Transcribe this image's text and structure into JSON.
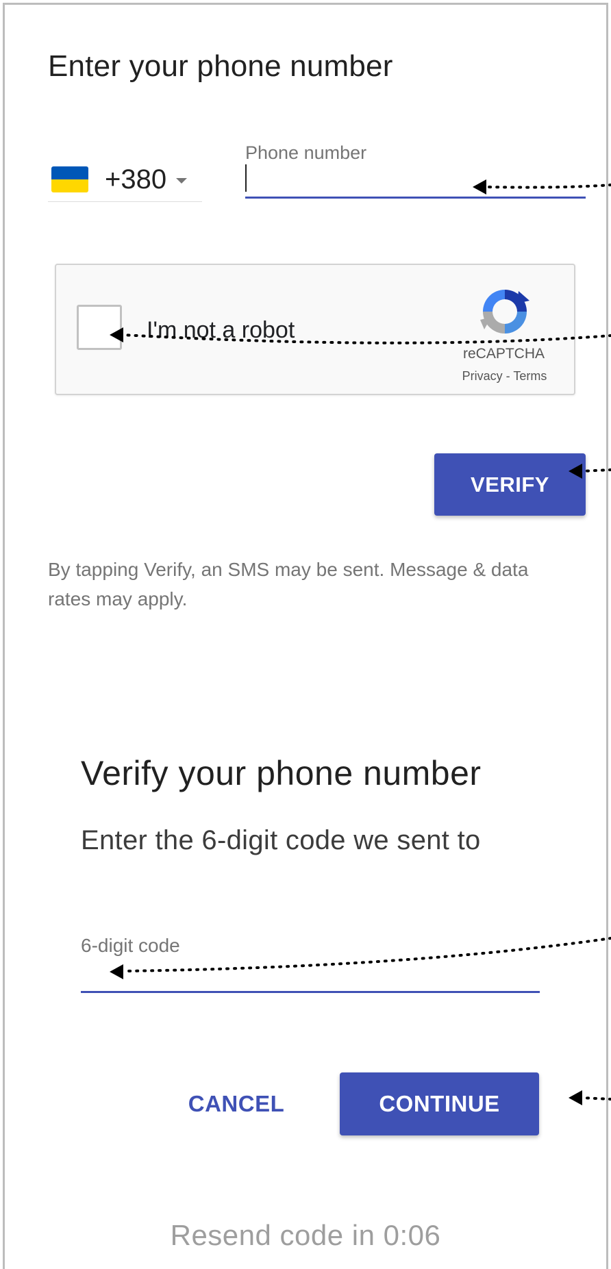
{
  "phone_step": {
    "title": "Enter your phone number",
    "country_code": "+380",
    "country_flag": "ukraine-flag-icon",
    "phone_label": "Phone number",
    "phone_value": "",
    "recaptcha": {
      "label": "I'm not a robot",
      "brand": "reCAPTCHA",
      "links": "Privacy - Terms"
    },
    "verify_button": "VERIFY",
    "disclaimer": "By tapping Verify, an SMS may be sent. Message & data rates may apply."
  },
  "code_step": {
    "title": "Verify your phone number",
    "subtitle": "Enter the 6-digit code we sent to",
    "code_label": "6-digit code",
    "code_value": "",
    "cancel_button": "CANCEL",
    "continue_button": "CONTINUE",
    "resend_text": "Resend code in 0:06"
  },
  "colors": {
    "primary": "#3f51b5",
    "flag_blue": "#0057b7",
    "flag_yellow": "#ffd700",
    "muted_text": "#757575",
    "annotation": "#000000"
  }
}
